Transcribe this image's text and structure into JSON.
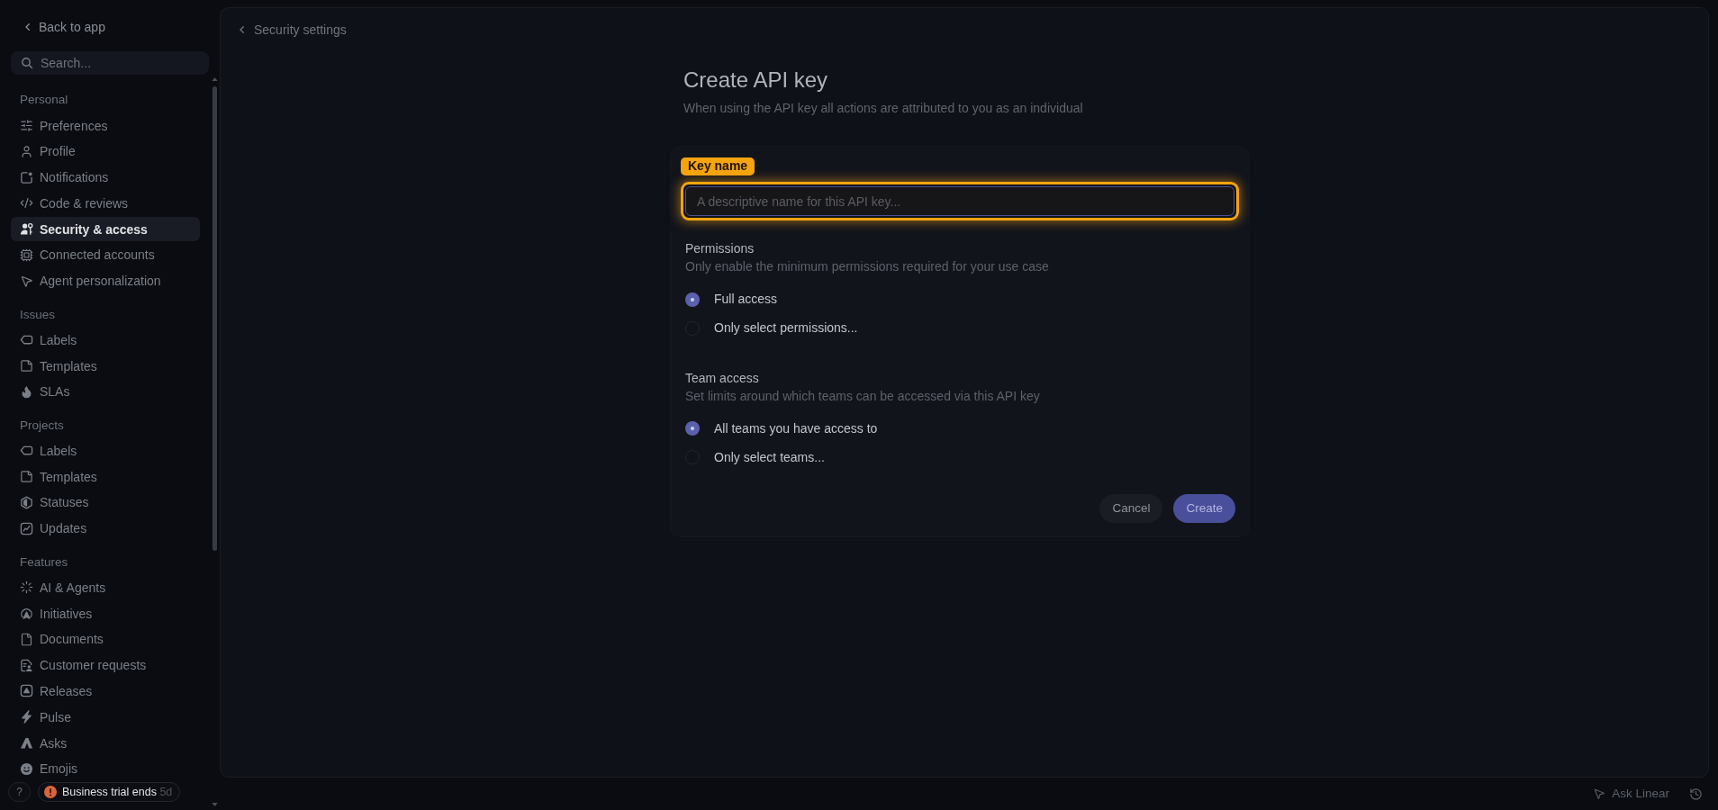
{
  "sidebar": {
    "back_link": "Back to app",
    "search": {
      "placeholder": "Search..."
    },
    "sections": [
      {
        "title": "Personal",
        "items": [
          {
            "label": "Preferences",
            "selected": false
          },
          {
            "label": "Profile",
            "selected": false
          },
          {
            "label": "Notifications",
            "selected": false
          },
          {
            "label": "Code & reviews",
            "selected": false
          },
          {
            "label": "Security & access",
            "selected": true
          },
          {
            "label": "Connected accounts",
            "selected": false
          },
          {
            "label": "Agent personalization",
            "selected": false
          }
        ]
      },
      {
        "title": "Issues",
        "items": [
          {
            "label": "Labels",
            "selected": false
          },
          {
            "label": "Templates",
            "selected": false
          },
          {
            "label": "SLAs",
            "selected": false
          }
        ]
      },
      {
        "title": "Projects",
        "items": [
          {
            "label": "Labels",
            "selected": false
          },
          {
            "label": "Templates",
            "selected": false
          },
          {
            "label": "Statuses",
            "selected": false
          },
          {
            "label": "Updates",
            "selected": false
          }
        ]
      },
      {
        "title": "Features",
        "items": [
          {
            "label": "AI & Agents",
            "selected": false
          },
          {
            "label": "Initiatives",
            "selected": false
          },
          {
            "label": "Documents",
            "selected": false
          },
          {
            "label": "Customer requests",
            "selected": false
          },
          {
            "label": "Releases",
            "selected": false
          },
          {
            "label": "Pulse",
            "selected": false
          },
          {
            "label": "Asks",
            "selected": false
          },
          {
            "label": "Emojis",
            "selected": false
          }
        ]
      }
    ],
    "help_button": "?",
    "trial_badge": {
      "label": "Business trial ends",
      "remaining": "5d"
    }
  },
  "main": {
    "breadcrumb": "Security settings",
    "title": "Create API key",
    "subtitle": "When using the API key all actions are attributed to you as an individual",
    "form": {
      "key_name": {
        "badge": "Key name",
        "placeholder": "A descriptive name for this API key...",
        "highlighted": true
      },
      "groups": [
        {
          "title": "Permissions",
          "description": "Only enable the minimum permissions required for your use case",
          "options": [
            {
              "label": "Full access",
              "selected": true
            },
            {
              "label": "Only select permissions...",
              "selected": false
            }
          ]
        },
        {
          "title": "Team access",
          "description": "Set limits around which teams can be accessed via this API key",
          "options": [
            {
              "label": "All teams you have access to",
              "selected": true
            },
            {
              "label": "Only select teams...",
              "selected": false
            }
          ]
        }
      ],
      "buttons": [
        {
          "label": "Cancel",
          "kind": "secondary"
        },
        {
          "label": "Create",
          "kind": "primary"
        }
      ]
    }
  },
  "footer": {
    "ask_button": "Ask Linear"
  }
}
